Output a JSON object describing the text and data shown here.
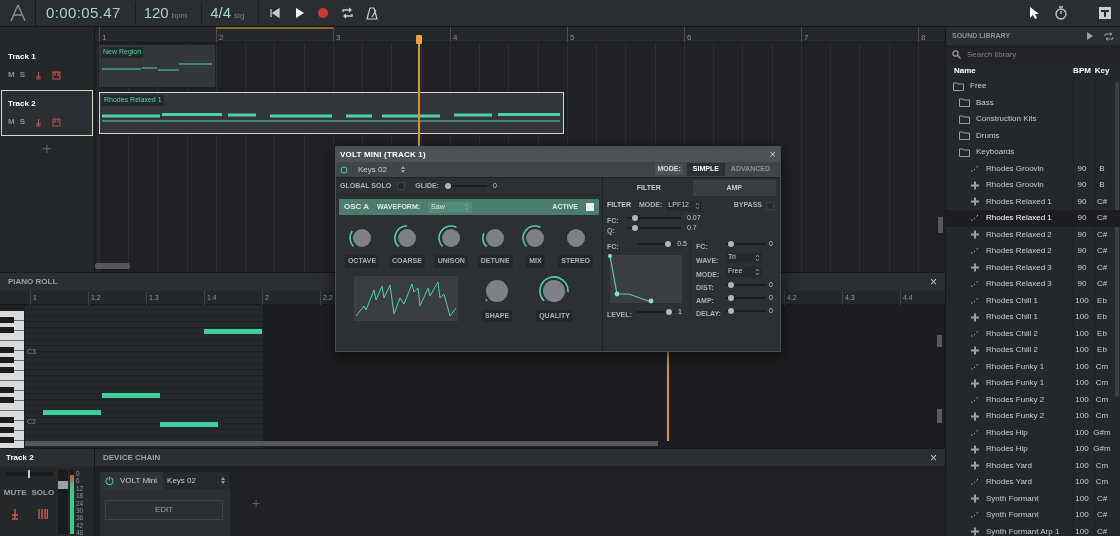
{
  "toolbar": {
    "time": "0:00:05.47",
    "tempo": "120",
    "tempo_unit": "bpm",
    "signature": "4/4",
    "signature_unit": "sig"
  },
  "arrangement": {
    "ruler": [
      "1",
      "2",
      "3",
      "4",
      "5",
      "6",
      "7",
      "8"
    ],
    "tracks": [
      {
        "name": "Track 1",
        "selected": false,
        "mute": "M",
        "solo": "S",
        "armed": true,
        "region": "New Region"
      },
      {
        "name": "Track 2",
        "selected": true,
        "mute": "M",
        "solo": "S",
        "armed": false,
        "region": "Rhodes Relaxed 1"
      }
    ],
    "add_track": "+"
  },
  "piano_roll": {
    "title": "PIANO ROLL",
    "close": "×",
    "ruler": [
      "1",
      "1.2",
      "1.3",
      "1.4",
      "2",
      "2.2",
      "4.2",
      "4.3",
      "4.4"
    ],
    "key_labels": [
      "C3",
      "C2"
    ]
  },
  "mixer": {
    "track": "Track 2",
    "pan": {
      "level": 0.5
    },
    "mute": "MUTE",
    "solo": "SOLO",
    "fader": {
      "level": 0.8
    },
    "meter": {
      "level": 0.92
    },
    "scale": [
      "0",
      "6",
      "12",
      "18",
      "24",
      "30",
      "36",
      "42",
      "48"
    ]
  },
  "device_chain": {
    "title": "DEVICE CHAIN",
    "close": "×",
    "device": {
      "name": "VOLT Mini",
      "on": true,
      "preset": "Keys 02",
      "edit": "EDIT"
    },
    "add": "+"
  },
  "synth": {
    "title": "VOLT MINI (TRACK 1)",
    "close": "×",
    "on": true,
    "preset": "Keys 02",
    "mode_label": "MODE:",
    "modes": [
      {
        "label": "SIMPLE",
        "selected": true
      },
      {
        "label": "ADVANCED",
        "selected": false
      }
    ],
    "global_solo": {
      "label": "GLOBAL SOLO",
      "checked": false
    },
    "glide": {
      "label": "GLIDE:",
      "level": 0,
      "reading": "0"
    },
    "osc": {
      "label": "OSC A",
      "waveform_label": "WAVEFORM:",
      "waveform": "Saw",
      "active_label": "ACTIVE",
      "active": true
    },
    "knobs": [
      {
        "label": "OCTAVE"
      },
      {
        "label": "COARSE"
      },
      {
        "label": "UNISON"
      },
      {
        "label": "DETUNE"
      },
      {
        "label": "MIX"
      },
      {
        "label": "STEREO"
      }
    ],
    "shape_knobs": [
      {
        "label": "SHAPE"
      },
      {
        "label": "QUALITY"
      }
    ],
    "tabs": [
      {
        "label": "FILTER",
        "selected": true
      },
      {
        "label": "AMP",
        "selected": false
      }
    ],
    "filter": {
      "label": "FILTER",
      "mode_label": "MODE:",
      "mode": "LPF12",
      "bypass_label": "BYPASS",
      "bypass": false,
      "params": [
        {
          "label": "FC:",
          "level": 0.1,
          "reading": "0.07"
        },
        {
          "label": "Q:",
          "level": 0.1,
          "reading": "0.7"
        }
      ]
    },
    "envelope": {
      "fc": {
        "label": "FC:",
        "level": 0.9,
        "reading": "0.5"
      },
      "level_param": {
        "label": "LEVEL:",
        "level": 0.9,
        "reading": "1"
      }
    },
    "lfo": {
      "fc": {
        "label": "FC:",
        "level": 0.05,
        "reading": "0"
      },
      "wave_label": "WAVE:",
      "wave": "Tri",
      "mode_label": "MODE:",
      "mode": "Free",
      "params": [
        {
          "label": "DIST:",
          "level": 0.05,
          "reading": "0"
        },
        {
          "label": "AMP:",
          "level": 0.05,
          "reading": "0"
        },
        {
          "label": "DELAY:",
          "level": 0.05,
          "reading": "0"
        }
      ]
    }
  },
  "library": {
    "title": "SOUND LIBRARY",
    "search": {
      "placeholder": "Search library"
    },
    "columns": [
      "Name",
      "BPM",
      "Key"
    ],
    "tree": [
      {
        "kind": "folder",
        "name": "Free",
        "selected": false,
        "children": [
          {
            "kind": "folder",
            "name": "Bass",
            "selected": false
          },
          {
            "kind": "folder",
            "name": "Construction Kits",
            "selected": false
          },
          {
            "kind": "folder",
            "name": "Drums",
            "selected": false
          },
          {
            "kind": "folder",
            "name": "Keyboards",
            "selected": false,
            "children": [
              {
                "kind": "loop",
                "name": "Rhodes Groovin",
                "bpm": "90",
                "key": "B",
                "selected": false
              },
              {
                "kind": "instrument",
                "name": "Rhodes Groovin",
                "bpm": "90",
                "key": "B",
                "selected": false
              },
              {
                "kind": "instrument",
                "name": "Rhodes Relaxed 1",
                "bpm": "90",
                "key": "C#",
                "selected": false
              },
              {
                "kind": "loop",
                "name": "Rhodes Relaxed 1",
                "bpm": "90",
                "key": "C#",
                "selected": true
              },
              {
                "kind": "instrument",
                "name": "Rhodes Relaxed 2",
                "bpm": "90",
                "key": "C#",
                "selected": false
              },
              {
                "kind": "loop",
                "name": "Rhodes Relaxed 2",
                "bpm": "90",
                "key": "C#",
                "selected": false
              },
              {
                "kind": "instrument",
                "name": "Rhodes Relaxed 3",
                "bpm": "90",
                "key": "C#",
                "selected": false
              },
              {
                "kind": "loop",
                "name": "Rhodes Relaxed 3",
                "bpm": "90",
                "key": "C#",
                "selected": false
              },
              {
                "kind": "loop",
                "name": "Rhodes Chill 1",
                "bpm": "100",
                "key": "Eb",
                "selected": false
              },
              {
                "kind": "instrument",
                "name": "Rhodes Chill 1",
                "bpm": "100",
                "key": "Eb",
                "selected": false
              },
              {
                "kind": "loop",
                "name": "Rhodes Chill 2",
                "bpm": "100",
                "key": "Eb",
                "selected": false
              },
              {
                "kind": "instrument",
                "name": "Rhodes Chill 2",
                "bpm": "100",
                "key": "Eb",
                "selected": false
              },
              {
                "kind": "loop",
                "name": "Rhodes Funky 1",
                "bpm": "100",
                "key": "Cm",
                "selected": false
              },
              {
                "kind": "instrument",
                "name": "Rhodes Funky 1",
                "bpm": "100",
                "key": "Cm",
                "selected": false
              },
              {
                "kind": "loop",
                "name": "Rhodes Funky 2",
                "bpm": "100",
                "key": "Cm",
                "selected": false
              },
              {
                "kind": "instrument",
                "name": "Rhodes Funky 2",
                "bpm": "100",
                "key": "Cm",
                "selected": false
              },
              {
                "kind": "loop",
                "name": "Rhodes Hip",
                "bpm": "100",
                "key": "G#m",
                "selected": false
              },
              {
                "kind": "instrument",
                "name": "Rhodes Hip",
                "bpm": "100",
                "key": "G#m",
                "selected": false
              },
              {
                "kind": "instrument",
                "name": "Rhodes Yard",
                "bpm": "100",
                "key": "Cm",
                "selected": false
              },
              {
                "kind": "loop",
                "name": "Rhodes Yard",
                "bpm": "100",
                "key": "Cm",
                "selected": false
              },
              {
                "kind": "instrument",
                "name": "Synth Formant",
                "bpm": "100",
                "key": "C#",
                "selected": false
              },
              {
                "kind": "loop",
                "name": "Synth Formant",
                "bpm": "100",
                "key": "C#",
                "selected": false
              },
              {
                "kind": "instrument",
                "name": "Synth Formant Arp 1",
                "bpm": "100",
                "key": "C#",
                "selected": false
              }
            ]
          }
        ]
      }
    ]
  }
}
